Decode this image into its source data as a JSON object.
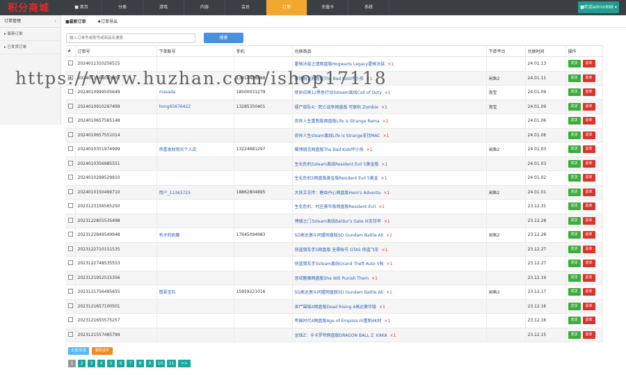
{
  "brand": {
    "logo_text": "积分商城",
    "logo_color": "#e12a2a",
    "accent": "#f0a830",
    "teal": "#1e9e8e"
  },
  "nav": [
    {
      "label": "■ 首页"
    },
    {
      "label": "分类"
    },
    {
      "label": "游戏"
    },
    {
      "label": "内容"
    },
    {
      "label": "会员"
    },
    {
      "label": "订单",
      "active": true
    },
    {
      "label": "充值卡"
    },
    {
      "label": "系统"
    }
  ],
  "user": {
    "label": "■欢迎admin888 ▾"
  },
  "sidebar": {
    "head": "订单管理",
    "items": [
      {
        "label": "最新订单"
      },
      {
        "label": "已发货订单"
      }
    ]
  },
  "tabs": {
    "current": "■最新订单",
    "export": "✚订单导出"
  },
  "search": {
    "placeholder": "输入订单号或账号或商品名搜索",
    "button": "搜索"
  },
  "table": {
    "headers": [
      "#",
      "订单号",
      "下单账号",
      "手机",
      "兑换商品",
      "下单平台",
      "兑换时间",
      "操作"
    ],
    "ship_label": "发货",
    "refund_label": "退单",
    "rows": [
      {
        "order": "2024011310256515",
        "account": "",
        "phone": "",
        "product": "霍格沃兹之遗网盘版Hogwarts Legacy霍格沃兹",
        "qty": "×1",
        "platform": "",
        "time": "24.01.13"
      },
      {
        "order": "2024011108080802",
        "account": "",
        "phone": "13914488888",
        "product": "赛博朋克网盘版The Bad Kids坏小孩",
        "qty": "×1",
        "platform": "闲鱼2",
        "time": "24.01.11"
      },
      {
        "order": "2024010999505649",
        "account": "masada",
        "phone": "18500031279",
        "product": "使命召唤12黑色行动3steam离线Call of Duty",
        "qty": "×1",
        "platform": "淘宝",
        "time": "24.01.09"
      },
      {
        "order": "2024010910297499",
        "account": "hong65676422",
        "phone": "13285350401",
        "product": "僵尸部队4：死亡战争网盘版 可联机 Zombie",
        "qty": "×1",
        "platform": "淘宝",
        "time": "24.01.09"
      },
      {
        "order": "2024010657565148",
        "account": "",
        "phone": "",
        "product": "奇异人生重制版网盘版Life is Strange Rema",
        "qty": "×1",
        "platform": "",
        "time": "24.01.06"
      },
      {
        "order": "2024010657551014",
        "account": "",
        "phone": "",
        "product": "奇异人生steam离线Life is Strange支持MAC",
        "qty": "×1",
        "platform": "",
        "time": "24.01.06"
      },
      {
        "order": "2024010351974999",
        "account": "恭喜发财用兵个人店",
        "phone": "13224681297",
        "product": "赛博朋克网盘版The Bad Kids坏小孩",
        "qty": "×1",
        "platform": "闲鱼2",
        "time": "24.01.03"
      },
      {
        "order": "2024010356985551",
        "account": "",
        "phone": "",
        "product": "生化危机5steam离线Resident Evil 5黄金版",
        "qty": "×1",
        "platform": "",
        "time": "24.01.03"
      },
      {
        "order": "2024010298529910",
        "account": "",
        "phone": "",
        "product": "生化危机5网盘版黄金版Resident Evil 5黄金",
        "qty": "×1",
        "platform": "",
        "time": "24.01.02"
      },
      {
        "order": "2024010150499710",
        "account": "用户_11363725",
        "phone": "18862804895",
        "product": "大侠立志传：碧血丹心网盘版Hero's Adventu",
        "qty": "×1",
        "platform": "闲鱼2",
        "time": "24.01.01"
      },
      {
        "order": "2023123156565250",
        "account": "",
        "phone": "",
        "product": "生化危机：村庄豪华版网盘版Resident Evil",
        "qty": "×1",
        "platform": "",
        "time": "23.12.31"
      },
      {
        "order": "2023122855535498",
        "account": "",
        "phone": "",
        "product": "博德之门3steam离线Baldur's Gate III支持苹",
        "qty": "×1",
        "platform": "",
        "time": "23.12.28"
      },
      {
        "order": "2023122849549948",
        "account": "有才的奶酪",
        "phone": "17645094983",
        "product": "SD高达激斗同盟网盘版SD Gundam Battle All",
        "qty": "×1",
        "platform": "闲鱼2",
        "time": "23.12.28"
      },
      {
        "order": "2023122710151535",
        "account": "",
        "phone": "",
        "product": "侠盗猎车手5网盘版 无需账号 GTA5 侠盗飞车",
        "qty": "×1",
        "platform": "",
        "time": "23.12.27"
      },
      {
        "order": "2023122748535553",
        "account": "",
        "phone": "",
        "product": "侠盗猎车手5steam离线Grand Theft Auto V秋",
        "qty": "×1",
        "platform": "",
        "time": "23.12.27"
      },
      {
        "order": "2023121952515356",
        "account": "",
        "phone": "",
        "product": "惩戒魅魔网盘版She Will Punish Them",
        "qty": "×1",
        "platform": "",
        "time": "23.12.19"
      },
      {
        "order": "2023121756495655",
        "account": "翡翠宝石",
        "phone": "15959221016",
        "product": "SD高达激斗同盟网盘版SD Gundam Battle All",
        "qty": "×1",
        "platform": "闲鱼2",
        "time": "23.12.17"
      },
      {
        "order": "2023121657100501",
        "account": "",
        "phone": "",
        "product": "丧尸围城4网盘版Dead Rising 4高达豪华版",
        "qty": "×1",
        "platform": "",
        "time": "23.12.16"
      },
      {
        "order": "2023121655575257",
        "account": "",
        "phone": "",
        "product": "帝国时代4网盘版Age of Empires IV重制4K材",
        "qty": "×1",
        "platform": "",
        "time": "23.12.16"
      },
      {
        "order": "2023121557485799",
        "account": "",
        "phone": "",
        "product": "龙珠Z：卡卡罗特网盘版DRAGON BALL Z: KAKA",
        "qty": "×1",
        "platform": "",
        "time": "23.12.15"
      }
    ]
  },
  "bulk": {
    "select_all": "全选/反选",
    "delete": "删除选中"
  },
  "pagination": [
    "1",
    "2",
    "3",
    "4",
    "5",
    "6",
    "7",
    "8",
    "9",
    "10",
    "11",
    ">>"
  ],
  "watermark": "https://www.huzhan.com/ishop17118"
}
